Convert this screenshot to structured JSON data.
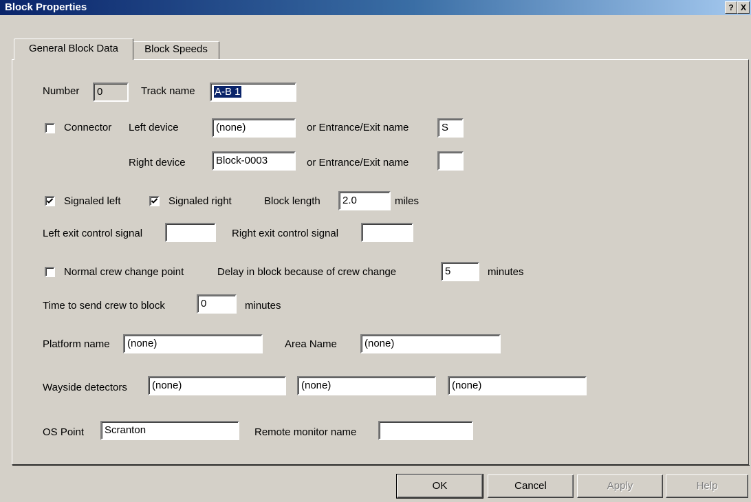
{
  "window": {
    "title": "Block Properties",
    "help_glyph": "?",
    "close_glyph": "X"
  },
  "tabs": [
    {
      "label": "General Block Data",
      "active": true
    },
    {
      "label": "Block Speeds",
      "active": false
    }
  ],
  "form": {
    "number": {
      "label": "Number",
      "value": "0"
    },
    "track_name": {
      "label": "Track name",
      "value": "A-B 1"
    },
    "connector": {
      "label": "Connector",
      "checked": false
    },
    "left_device": {
      "label": "Left device",
      "value": "(none)"
    },
    "left_entrance": {
      "label": "or Entrance/Exit name",
      "value": "S"
    },
    "right_device": {
      "label": "Right device",
      "value": "Block-0003"
    },
    "right_entrance": {
      "label": "or Entrance/Exit name",
      "value": ""
    },
    "signaled_left": {
      "label": "Signaled left",
      "checked": true
    },
    "signaled_right": {
      "label": "Signaled right",
      "checked": true
    },
    "block_length": {
      "label": "Block length",
      "value": "2.0",
      "unit": "miles"
    },
    "left_exit_signal": {
      "label": "Left exit control signal",
      "value": ""
    },
    "right_exit_signal": {
      "label": "Right exit control signal",
      "value": ""
    },
    "crew_change_point": {
      "label": "Normal crew change point",
      "checked": false
    },
    "crew_delay": {
      "label": "Delay in block because of crew change",
      "value": "5",
      "unit": "minutes"
    },
    "time_to_send_crew": {
      "label": "Time to send crew to block",
      "value": "0",
      "unit": "minutes"
    },
    "platform_name": {
      "label": "Platform name",
      "value": "(none)"
    },
    "area_name": {
      "label": "Area Name",
      "value": "(none)"
    },
    "wayside_detectors": {
      "label": "Wayside detectors",
      "values": [
        "(none)",
        "(none)",
        "(none)"
      ]
    },
    "os_point": {
      "label": "OS Point",
      "value": "Scranton"
    },
    "remote_monitor": {
      "label": "Remote monitor name",
      "value": ""
    }
  },
  "buttons": {
    "ok": "OK",
    "cancel": "Cancel",
    "apply": "Apply",
    "help": "Help"
  }
}
